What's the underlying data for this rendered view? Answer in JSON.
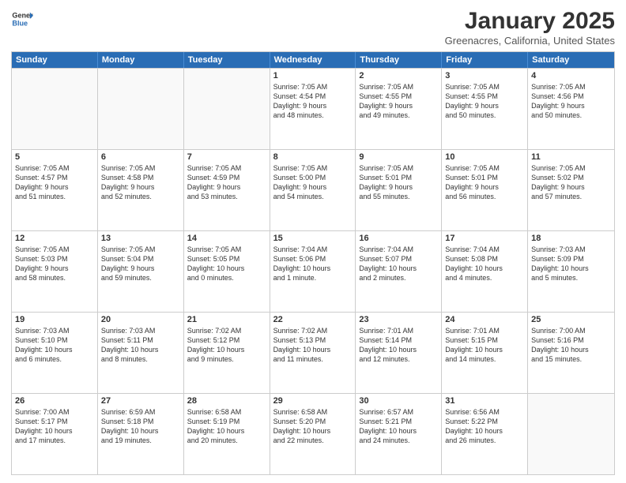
{
  "header": {
    "logo_general": "General",
    "logo_blue": "Blue",
    "month_title": "January 2025",
    "location": "Greenacres, California, United States"
  },
  "weekdays": [
    "Sunday",
    "Monday",
    "Tuesday",
    "Wednesday",
    "Thursday",
    "Friday",
    "Saturday"
  ],
  "rows": [
    [
      {
        "day": "",
        "text": ""
      },
      {
        "day": "",
        "text": ""
      },
      {
        "day": "",
        "text": ""
      },
      {
        "day": "1",
        "text": "Sunrise: 7:05 AM\nSunset: 4:54 PM\nDaylight: 9 hours\nand 48 minutes."
      },
      {
        "day": "2",
        "text": "Sunrise: 7:05 AM\nSunset: 4:55 PM\nDaylight: 9 hours\nand 49 minutes."
      },
      {
        "day": "3",
        "text": "Sunrise: 7:05 AM\nSunset: 4:55 PM\nDaylight: 9 hours\nand 50 minutes."
      },
      {
        "day": "4",
        "text": "Sunrise: 7:05 AM\nSunset: 4:56 PM\nDaylight: 9 hours\nand 50 minutes."
      }
    ],
    [
      {
        "day": "5",
        "text": "Sunrise: 7:05 AM\nSunset: 4:57 PM\nDaylight: 9 hours\nand 51 minutes."
      },
      {
        "day": "6",
        "text": "Sunrise: 7:05 AM\nSunset: 4:58 PM\nDaylight: 9 hours\nand 52 minutes."
      },
      {
        "day": "7",
        "text": "Sunrise: 7:05 AM\nSunset: 4:59 PM\nDaylight: 9 hours\nand 53 minutes."
      },
      {
        "day": "8",
        "text": "Sunrise: 7:05 AM\nSunset: 5:00 PM\nDaylight: 9 hours\nand 54 minutes."
      },
      {
        "day": "9",
        "text": "Sunrise: 7:05 AM\nSunset: 5:01 PM\nDaylight: 9 hours\nand 55 minutes."
      },
      {
        "day": "10",
        "text": "Sunrise: 7:05 AM\nSunset: 5:01 PM\nDaylight: 9 hours\nand 56 minutes."
      },
      {
        "day": "11",
        "text": "Sunrise: 7:05 AM\nSunset: 5:02 PM\nDaylight: 9 hours\nand 57 minutes."
      }
    ],
    [
      {
        "day": "12",
        "text": "Sunrise: 7:05 AM\nSunset: 5:03 PM\nDaylight: 9 hours\nand 58 minutes."
      },
      {
        "day": "13",
        "text": "Sunrise: 7:05 AM\nSunset: 5:04 PM\nDaylight: 9 hours\nand 59 minutes."
      },
      {
        "day": "14",
        "text": "Sunrise: 7:05 AM\nSunset: 5:05 PM\nDaylight: 10 hours\nand 0 minutes."
      },
      {
        "day": "15",
        "text": "Sunrise: 7:04 AM\nSunset: 5:06 PM\nDaylight: 10 hours\nand 1 minute."
      },
      {
        "day": "16",
        "text": "Sunrise: 7:04 AM\nSunset: 5:07 PM\nDaylight: 10 hours\nand 2 minutes."
      },
      {
        "day": "17",
        "text": "Sunrise: 7:04 AM\nSunset: 5:08 PM\nDaylight: 10 hours\nand 4 minutes."
      },
      {
        "day": "18",
        "text": "Sunrise: 7:03 AM\nSunset: 5:09 PM\nDaylight: 10 hours\nand 5 minutes."
      }
    ],
    [
      {
        "day": "19",
        "text": "Sunrise: 7:03 AM\nSunset: 5:10 PM\nDaylight: 10 hours\nand 6 minutes."
      },
      {
        "day": "20",
        "text": "Sunrise: 7:03 AM\nSunset: 5:11 PM\nDaylight: 10 hours\nand 8 minutes."
      },
      {
        "day": "21",
        "text": "Sunrise: 7:02 AM\nSunset: 5:12 PM\nDaylight: 10 hours\nand 9 minutes."
      },
      {
        "day": "22",
        "text": "Sunrise: 7:02 AM\nSunset: 5:13 PM\nDaylight: 10 hours\nand 11 minutes."
      },
      {
        "day": "23",
        "text": "Sunrise: 7:01 AM\nSunset: 5:14 PM\nDaylight: 10 hours\nand 12 minutes."
      },
      {
        "day": "24",
        "text": "Sunrise: 7:01 AM\nSunset: 5:15 PM\nDaylight: 10 hours\nand 14 minutes."
      },
      {
        "day": "25",
        "text": "Sunrise: 7:00 AM\nSunset: 5:16 PM\nDaylight: 10 hours\nand 15 minutes."
      }
    ],
    [
      {
        "day": "26",
        "text": "Sunrise: 7:00 AM\nSunset: 5:17 PM\nDaylight: 10 hours\nand 17 minutes."
      },
      {
        "day": "27",
        "text": "Sunrise: 6:59 AM\nSunset: 5:18 PM\nDaylight: 10 hours\nand 19 minutes."
      },
      {
        "day": "28",
        "text": "Sunrise: 6:58 AM\nSunset: 5:19 PM\nDaylight: 10 hours\nand 20 minutes."
      },
      {
        "day": "29",
        "text": "Sunrise: 6:58 AM\nSunset: 5:20 PM\nDaylight: 10 hours\nand 22 minutes."
      },
      {
        "day": "30",
        "text": "Sunrise: 6:57 AM\nSunset: 5:21 PM\nDaylight: 10 hours\nand 24 minutes."
      },
      {
        "day": "31",
        "text": "Sunrise: 6:56 AM\nSunset: 5:22 PM\nDaylight: 10 hours\nand 26 minutes."
      },
      {
        "day": "",
        "text": ""
      }
    ]
  ]
}
